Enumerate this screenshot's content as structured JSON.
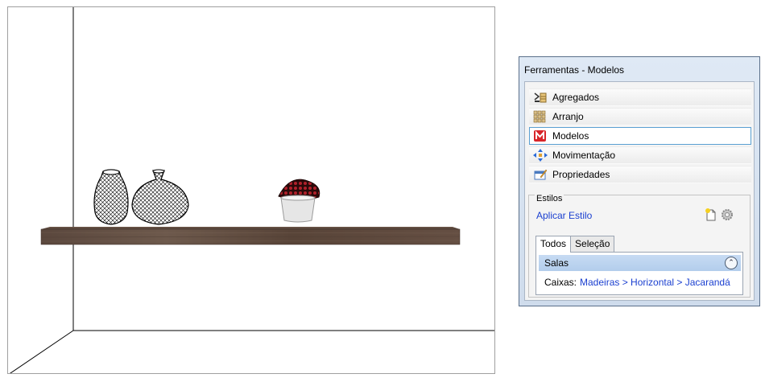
{
  "panel": {
    "title": "Ferramentas - Modelos",
    "items": [
      {
        "label": "Agregados",
        "icon": "aggregates-icon",
        "selected": false
      },
      {
        "label": "Arranjo",
        "icon": "arrangement-grid-icon",
        "selected": false
      },
      {
        "label": "Modelos",
        "icon": "models-m-icon",
        "selected": true
      },
      {
        "label": "Movimentação",
        "icon": "move-arrows-icon",
        "selected": false
      },
      {
        "label": "Propriedades",
        "icon": "properties-icon",
        "selected": false
      }
    ],
    "styles": {
      "legend": "Estilos",
      "apply_label": "Aplicar Estilo",
      "tabs": [
        {
          "label": "Todos",
          "active": true
        },
        {
          "label": "Seleção",
          "active": false
        }
      ],
      "group_header": "Salas",
      "row_label": "Caixas:",
      "row_value": "Madeiras > Horizontal > Jacarandá"
    },
    "colors": {
      "link": "#1a3fd0",
      "selection_border": "#5aa0d2",
      "group_header": "#c7dbf3"
    }
  },
  "scene": {
    "objects": [
      "wireframe-vase-tall",
      "wireframe-vase-round",
      "flower-pot",
      "wooden-shelf"
    ],
    "shelf_color": "#5e4a3d"
  }
}
